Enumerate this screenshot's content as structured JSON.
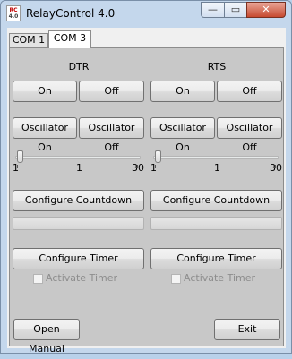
{
  "window": {
    "title": "RelayControl 4.0",
    "icon_text_top": "RC",
    "icon_text_bottom": "4.0",
    "minimize_glyph": "—",
    "maximize_glyph": "▭",
    "close_glyph": "✕"
  },
  "tabs": [
    {
      "label": "COM 1",
      "selected": false
    },
    {
      "label": "COM 3",
      "selected": true
    }
  ],
  "channels": {
    "dtr": {
      "heading": "DTR",
      "on_label": "On",
      "off_label": "Off",
      "osc_on_label": "Oscillator On",
      "osc_off_label": "Oscillator Off",
      "slider": {
        "min_label": "1",
        "value_label": "1",
        "max_label": "30",
        "min": 1,
        "max": 30,
        "value": 1
      },
      "countdown_label": "Configure Countdown",
      "progress": 0,
      "timer_label": "Configure Timer",
      "activate_label": "Activate Timer"
    },
    "rts": {
      "heading": "RTS",
      "on_label": "On",
      "off_label": "Off",
      "osc_on_label": "Oscillator On",
      "osc_off_label": "Oscillator Off",
      "slider": {
        "min_label": "1",
        "value_label": "1",
        "max_label": "30",
        "min": 1,
        "max": 30,
        "value": 1
      },
      "countdown_label": "Configure Countdown",
      "progress": 0,
      "timer_label": "Configure Timer",
      "activate_label": "Activate Timer"
    }
  },
  "footer": {
    "open_manual_label": "Open Manual",
    "exit_label": "Exit"
  },
  "colors": {
    "frame": "#c4d7ec",
    "panel": "#c8c8c8",
    "close_button": "#c7492f"
  }
}
